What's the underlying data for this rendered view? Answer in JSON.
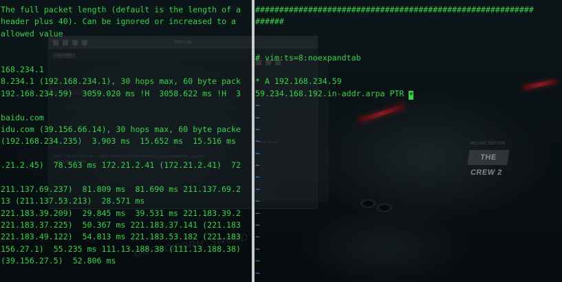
{
  "wallpaper": {
    "badge_text": "THE CREW 2",
    "badge_subtitle": "ARCADE EDITION",
    "watermark": "@CRUCIFORM_SWORD"
  },
  "ghost_window": {
    "title": "Ettercap",
    "tab": "lo / eth0",
    "lines": [
      "192.168.234.235  78:4C:36:E5:07:4A",
      "HTTP : 183.194.238.87:80 -> USER: 3075023704  PASS:   INFO: bai.yajuo.com/js/log/enter_log.php",
      "CONTENT: 20150904"
    ]
  },
  "ghost_window2": {
    "title": "Host Targets"
  },
  "left_terminal": {
    "lines": [
      "The full packet length (default is the length of a",
      "header plus 40). Can be ignored or increased to a",
      "allowed value",
      "",
      "",
      "168.234.1",
      "8.234.1 (192.168.234.1), 30 hops max, 60 byte pack",
      "192.168.234.59)  3059.020 ms !H  3058.622 ms !H  3",
      "",
      "baidu.com",
      "idu.com (39.156.66.14), 30 hops max, 60 byte packe",
      "(192.168.234.235)  3.903 ms  15.652 ms  15.516 ms",
      "",
      ".21.2.45)  78.563 ms 172.21.2.41 (172.21.2.41)  72",
      "",
      "211.137.69.237)  81.809 ms  81.690 ms 211.137.69.2",
      "13 (211.137.53.213)  28.571 ms",
      "221.183.39.209)  29.845 ms  39.531 ms 221.183.39.2",
      "221.183.37.225)  50.367 ms 221.183.37.141 (221.183",
      "221.183.49.122)  54.813 ms 221.183.53.182 (221.183",
      "156.27.1)  55.235 ms 111.13.188.38 (111.13.188.38)",
      "(39.156.27.5)  52.806 ms"
    ]
  },
  "right_terminal": {
    "lines": [
      "##########################################################",
      "######",
      "",
      "",
      "# vim:ts=8:noexpandtab",
      "",
      "* A 192.168.234.59",
      "59.234.168.192.in-addr.arpa PTR "
    ],
    "cursor_char": "*",
    "tilde": "~",
    "tilde_count": 15
  }
}
